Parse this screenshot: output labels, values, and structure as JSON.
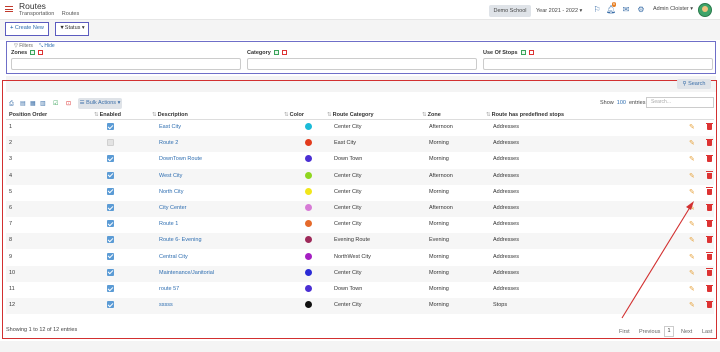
{
  "header": {
    "title": "Routes",
    "breadcrumb": [
      "Transportation",
      "Routes"
    ],
    "school": "Demo School",
    "year": "Year 2021 - 2022",
    "notif_count": "6",
    "user": "Admin Cloister"
  },
  "toolbar": {
    "create_label": "Create New",
    "status_label": "Status"
  },
  "filters": {
    "title": "Filters",
    "hide": "Hide",
    "labels": [
      "Zones",
      "Category",
      "Use Of Stops"
    ]
  },
  "search_label": "Search",
  "table_tools": {
    "bulk": "Bulk Actions",
    "show": "Show",
    "entries_count": "100",
    "entries": "entries",
    "search_placeholder": "Search..."
  },
  "columns": [
    "Position Order",
    "Enabled",
    "Description",
    "Color",
    "Route Category",
    "Zone",
    "Route has predefined stops"
  ],
  "rows": [
    {
      "pos": "1",
      "enabled": true,
      "desc": "East City",
      "color": "#1bbbd8",
      "cat": "Center City",
      "zone": "Afternoon",
      "stops": "Addresses"
    },
    {
      "pos": "2",
      "enabled": false,
      "desc": "Route 2",
      "color": "#e23b1d",
      "cat": "East City",
      "zone": "Morning",
      "stops": "Addresses"
    },
    {
      "pos": "3",
      "enabled": true,
      "desc": "DownTown Route",
      "color": "#4b2fd3",
      "cat": "Down Town",
      "zone": "Morning",
      "stops": "Addresses"
    },
    {
      "pos": "4",
      "enabled": true,
      "desc": "West City",
      "color": "#8fd61f",
      "cat": "Center City",
      "zone": "Afternoon",
      "stops": "Addresses"
    },
    {
      "pos": "5",
      "enabled": true,
      "desc": "North City",
      "color": "#f1e61a",
      "cat": "Center City",
      "zone": "Morning",
      "stops": "Addresses"
    },
    {
      "pos": "6",
      "enabled": true,
      "desc": "City Center",
      "color": "#d77bd6",
      "cat": "Center City",
      "zone": "Afternoon",
      "stops": "Addresses"
    },
    {
      "pos": "7",
      "enabled": true,
      "desc": "Route 1",
      "color": "#e56a2b",
      "cat": "Center City",
      "zone": "Morning",
      "stops": "Addresses"
    },
    {
      "pos": "8",
      "enabled": true,
      "desc": "Route 6- Evening",
      "color": "#9e2a5a",
      "cat": "Evening Route",
      "zone": "Evening",
      "stops": "Addresses"
    },
    {
      "pos": "9",
      "enabled": true,
      "desc": "Central City",
      "color": "#a51fc2",
      "cat": "NorthWest City",
      "zone": "Morning",
      "stops": "Addresses"
    },
    {
      "pos": "10",
      "enabled": true,
      "desc": "Maintenance/Janitorial",
      "color": "#2b2bd6",
      "cat": "Center City",
      "zone": "Morning",
      "stops": "Addresses"
    },
    {
      "pos": "11",
      "enabled": true,
      "desc": "route 57",
      "color": "#4b2fd3",
      "cat": "Down Town",
      "zone": "Morning",
      "stops": "Addresses"
    },
    {
      "pos": "12",
      "enabled": true,
      "desc": "sssss",
      "color": "#111111",
      "cat": "Center City",
      "zone": "Morning",
      "stops": "Stops"
    }
  ],
  "footer": {
    "info": "Showing 1 to 12 of 12 entries",
    "pages": [
      "First",
      "Previous",
      "1",
      "Next",
      "Last"
    ]
  },
  "colors": {
    "accent": "#2d6db0",
    "annotation": "#d23030",
    "highlight": "#5b5bbf"
  },
  "icons": [
    "menu-icon",
    "flag-icon",
    "bell-icon",
    "mail-icon",
    "settings-icon",
    "filter-icon",
    "edit-icon",
    "trash-icon"
  ]
}
